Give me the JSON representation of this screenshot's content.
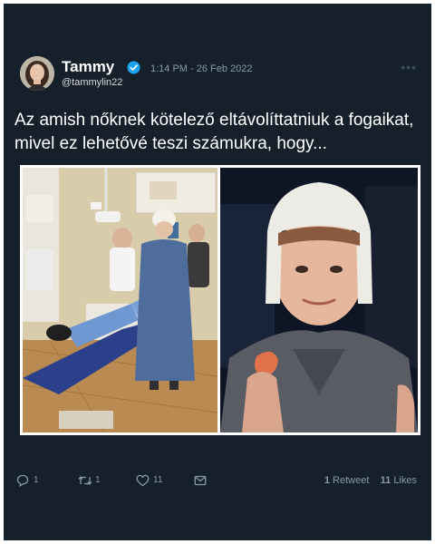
{
  "tweet": {
    "author_name": "Tammy",
    "author_handle": "@tammylin22",
    "timestamp": "1:14 PM - 26 Feb 2022",
    "text": "Az amish nőknek kötelező eltávolíttatniuk a fogaikat, mivel ez lehetővé teszi számukra, hogy...",
    "verified": true
  },
  "actions": {
    "reply_count": "1",
    "retweet_count": "1",
    "like_count": "11"
  },
  "stats": {
    "retweets_value": "1",
    "retweets_label": "Retweet",
    "likes_value": "11",
    "likes_label": "Likes"
  },
  "icons": {
    "verified": "verified-badge-icon",
    "more": "more-options-icon",
    "reply": "reply-icon",
    "retweet": "retweet-icon",
    "like": "heart-icon",
    "dm": "mail-icon"
  },
  "colors": {
    "background": "#15202b",
    "secondary_text": "#8899a6",
    "verified_blue": "#1da1f2",
    "text": "#ffffff"
  }
}
